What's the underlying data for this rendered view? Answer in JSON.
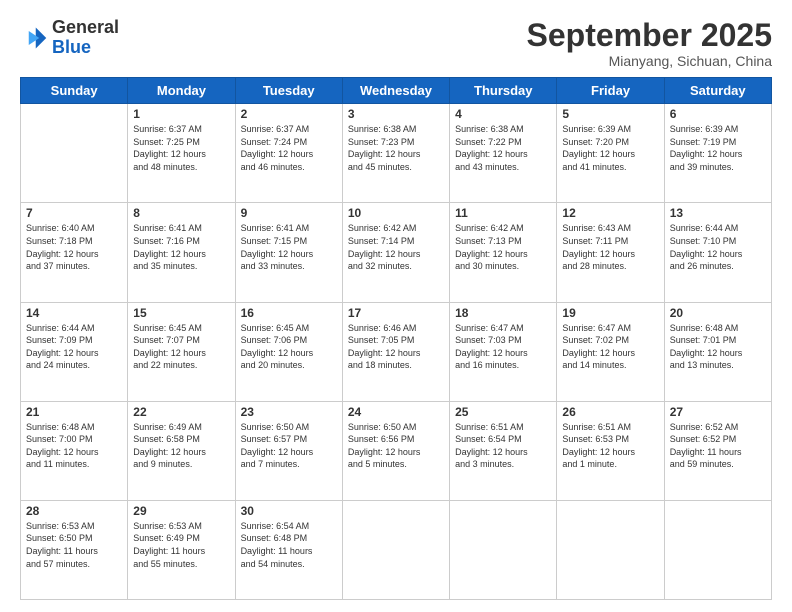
{
  "logo": {
    "general": "General",
    "blue": "Blue"
  },
  "header": {
    "month": "September 2025",
    "location": "Mianyang, Sichuan, China"
  },
  "weekdays": [
    "Sunday",
    "Monday",
    "Tuesday",
    "Wednesday",
    "Thursday",
    "Friday",
    "Saturday"
  ],
  "weeks": [
    [
      {
        "day": "",
        "info": ""
      },
      {
        "day": "1",
        "info": "Sunrise: 6:37 AM\nSunset: 7:25 PM\nDaylight: 12 hours\nand 48 minutes."
      },
      {
        "day": "2",
        "info": "Sunrise: 6:37 AM\nSunset: 7:24 PM\nDaylight: 12 hours\nand 46 minutes."
      },
      {
        "day": "3",
        "info": "Sunrise: 6:38 AM\nSunset: 7:23 PM\nDaylight: 12 hours\nand 45 minutes."
      },
      {
        "day": "4",
        "info": "Sunrise: 6:38 AM\nSunset: 7:22 PM\nDaylight: 12 hours\nand 43 minutes."
      },
      {
        "day": "5",
        "info": "Sunrise: 6:39 AM\nSunset: 7:20 PM\nDaylight: 12 hours\nand 41 minutes."
      },
      {
        "day": "6",
        "info": "Sunrise: 6:39 AM\nSunset: 7:19 PM\nDaylight: 12 hours\nand 39 minutes."
      }
    ],
    [
      {
        "day": "7",
        "info": "Sunrise: 6:40 AM\nSunset: 7:18 PM\nDaylight: 12 hours\nand 37 minutes."
      },
      {
        "day": "8",
        "info": "Sunrise: 6:41 AM\nSunset: 7:16 PM\nDaylight: 12 hours\nand 35 minutes."
      },
      {
        "day": "9",
        "info": "Sunrise: 6:41 AM\nSunset: 7:15 PM\nDaylight: 12 hours\nand 33 minutes."
      },
      {
        "day": "10",
        "info": "Sunrise: 6:42 AM\nSunset: 7:14 PM\nDaylight: 12 hours\nand 32 minutes."
      },
      {
        "day": "11",
        "info": "Sunrise: 6:42 AM\nSunset: 7:13 PM\nDaylight: 12 hours\nand 30 minutes."
      },
      {
        "day": "12",
        "info": "Sunrise: 6:43 AM\nSunset: 7:11 PM\nDaylight: 12 hours\nand 28 minutes."
      },
      {
        "day": "13",
        "info": "Sunrise: 6:44 AM\nSunset: 7:10 PM\nDaylight: 12 hours\nand 26 minutes."
      }
    ],
    [
      {
        "day": "14",
        "info": "Sunrise: 6:44 AM\nSunset: 7:09 PM\nDaylight: 12 hours\nand 24 minutes."
      },
      {
        "day": "15",
        "info": "Sunrise: 6:45 AM\nSunset: 7:07 PM\nDaylight: 12 hours\nand 22 minutes."
      },
      {
        "day": "16",
        "info": "Sunrise: 6:45 AM\nSunset: 7:06 PM\nDaylight: 12 hours\nand 20 minutes."
      },
      {
        "day": "17",
        "info": "Sunrise: 6:46 AM\nSunset: 7:05 PM\nDaylight: 12 hours\nand 18 minutes."
      },
      {
        "day": "18",
        "info": "Sunrise: 6:47 AM\nSunset: 7:03 PM\nDaylight: 12 hours\nand 16 minutes."
      },
      {
        "day": "19",
        "info": "Sunrise: 6:47 AM\nSunset: 7:02 PM\nDaylight: 12 hours\nand 14 minutes."
      },
      {
        "day": "20",
        "info": "Sunrise: 6:48 AM\nSunset: 7:01 PM\nDaylight: 12 hours\nand 13 minutes."
      }
    ],
    [
      {
        "day": "21",
        "info": "Sunrise: 6:48 AM\nSunset: 7:00 PM\nDaylight: 12 hours\nand 11 minutes."
      },
      {
        "day": "22",
        "info": "Sunrise: 6:49 AM\nSunset: 6:58 PM\nDaylight: 12 hours\nand 9 minutes."
      },
      {
        "day": "23",
        "info": "Sunrise: 6:50 AM\nSunset: 6:57 PM\nDaylight: 12 hours\nand 7 minutes."
      },
      {
        "day": "24",
        "info": "Sunrise: 6:50 AM\nSunset: 6:56 PM\nDaylight: 12 hours\nand 5 minutes."
      },
      {
        "day": "25",
        "info": "Sunrise: 6:51 AM\nSunset: 6:54 PM\nDaylight: 12 hours\nand 3 minutes."
      },
      {
        "day": "26",
        "info": "Sunrise: 6:51 AM\nSunset: 6:53 PM\nDaylight: 12 hours\nand 1 minute."
      },
      {
        "day": "27",
        "info": "Sunrise: 6:52 AM\nSunset: 6:52 PM\nDaylight: 11 hours\nand 59 minutes."
      }
    ],
    [
      {
        "day": "28",
        "info": "Sunrise: 6:53 AM\nSunset: 6:50 PM\nDaylight: 11 hours\nand 57 minutes."
      },
      {
        "day": "29",
        "info": "Sunrise: 6:53 AM\nSunset: 6:49 PM\nDaylight: 11 hours\nand 55 minutes."
      },
      {
        "day": "30",
        "info": "Sunrise: 6:54 AM\nSunset: 6:48 PM\nDaylight: 11 hours\nand 54 minutes."
      },
      {
        "day": "",
        "info": ""
      },
      {
        "day": "",
        "info": ""
      },
      {
        "day": "",
        "info": ""
      },
      {
        "day": "",
        "info": ""
      }
    ]
  ]
}
